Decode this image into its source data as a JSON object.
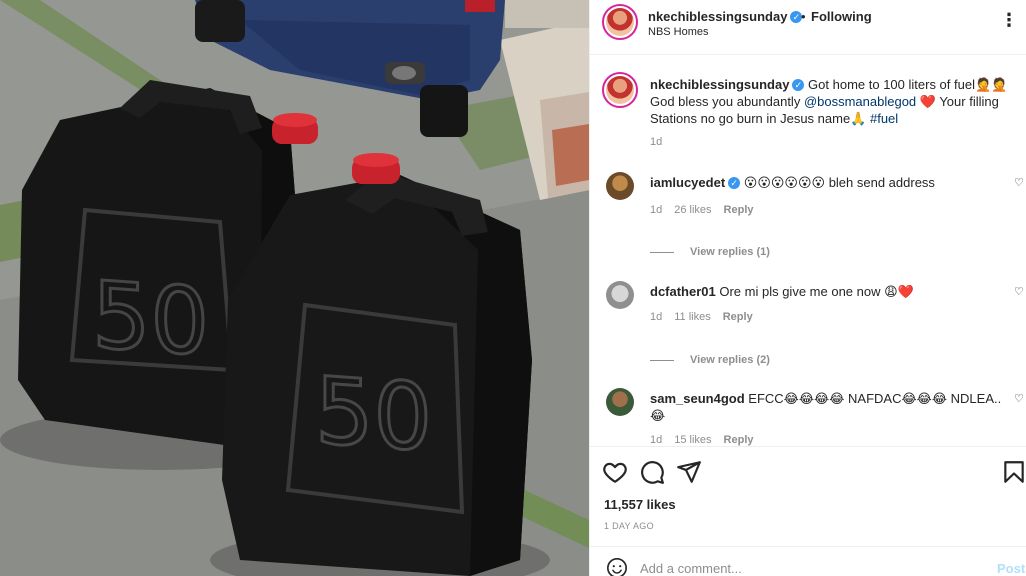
{
  "colors": {
    "verified": "#3897f0",
    "mention": "#00376b",
    "heart": "#ed4956",
    "post_disabled": "#b2dffc",
    "muted": "#8e8e8e"
  },
  "photo": {
    "can_number_left": "50",
    "can_number_right": "50"
  },
  "header": {
    "username": "nkechiblessingsunday",
    "separator": "•",
    "follow_state": "Following",
    "location": "NBS Homes",
    "more_icon": "ellipsis-icon"
  },
  "caption": {
    "username": "nkechiblessingsunday",
    "text_part1": " Got home to 100 liters of fuel🤦🤦 God bless you abundantly ",
    "mention": "@bossmanablegod",
    "text_part2": " ❤️ Your filling Stations no go burn in Jesus name🙏 ",
    "hashtag": "#fuel",
    "time": "1d"
  },
  "comments": [
    {
      "username": "iamlucyedet",
      "verified": true,
      "text": " 😮😮😮😮😮😮 bleh send address",
      "time": "1d",
      "likes": "26 likes",
      "reply": "Reply",
      "view_replies": "View replies (1)"
    },
    {
      "username": "dcfather01",
      "verified": false,
      "text": " Ore mi pls give me one now 😩❤️",
      "time": "1d",
      "likes": "11 likes",
      "reply": "Reply",
      "view_replies": "View replies (2)"
    },
    {
      "username": "sam_seun4god",
      "verified": false,
      "text": " EFCC😂😂😂😂 NAFDAC😂😂😂 NDLEA.. 😂",
      "time": "1d",
      "likes": "15 likes",
      "reply": "Reply",
      "view_replies": ""
    }
  ],
  "actions": {
    "icons": [
      "heart-icon",
      "comment-icon",
      "share-icon",
      "bookmark-icon"
    ],
    "likes": "11,557 likes",
    "age": "1 DAY AGO"
  },
  "composer": {
    "placeholder": "Add a comment...",
    "post_label": "Post",
    "emoji_icon": "smiley-icon"
  }
}
